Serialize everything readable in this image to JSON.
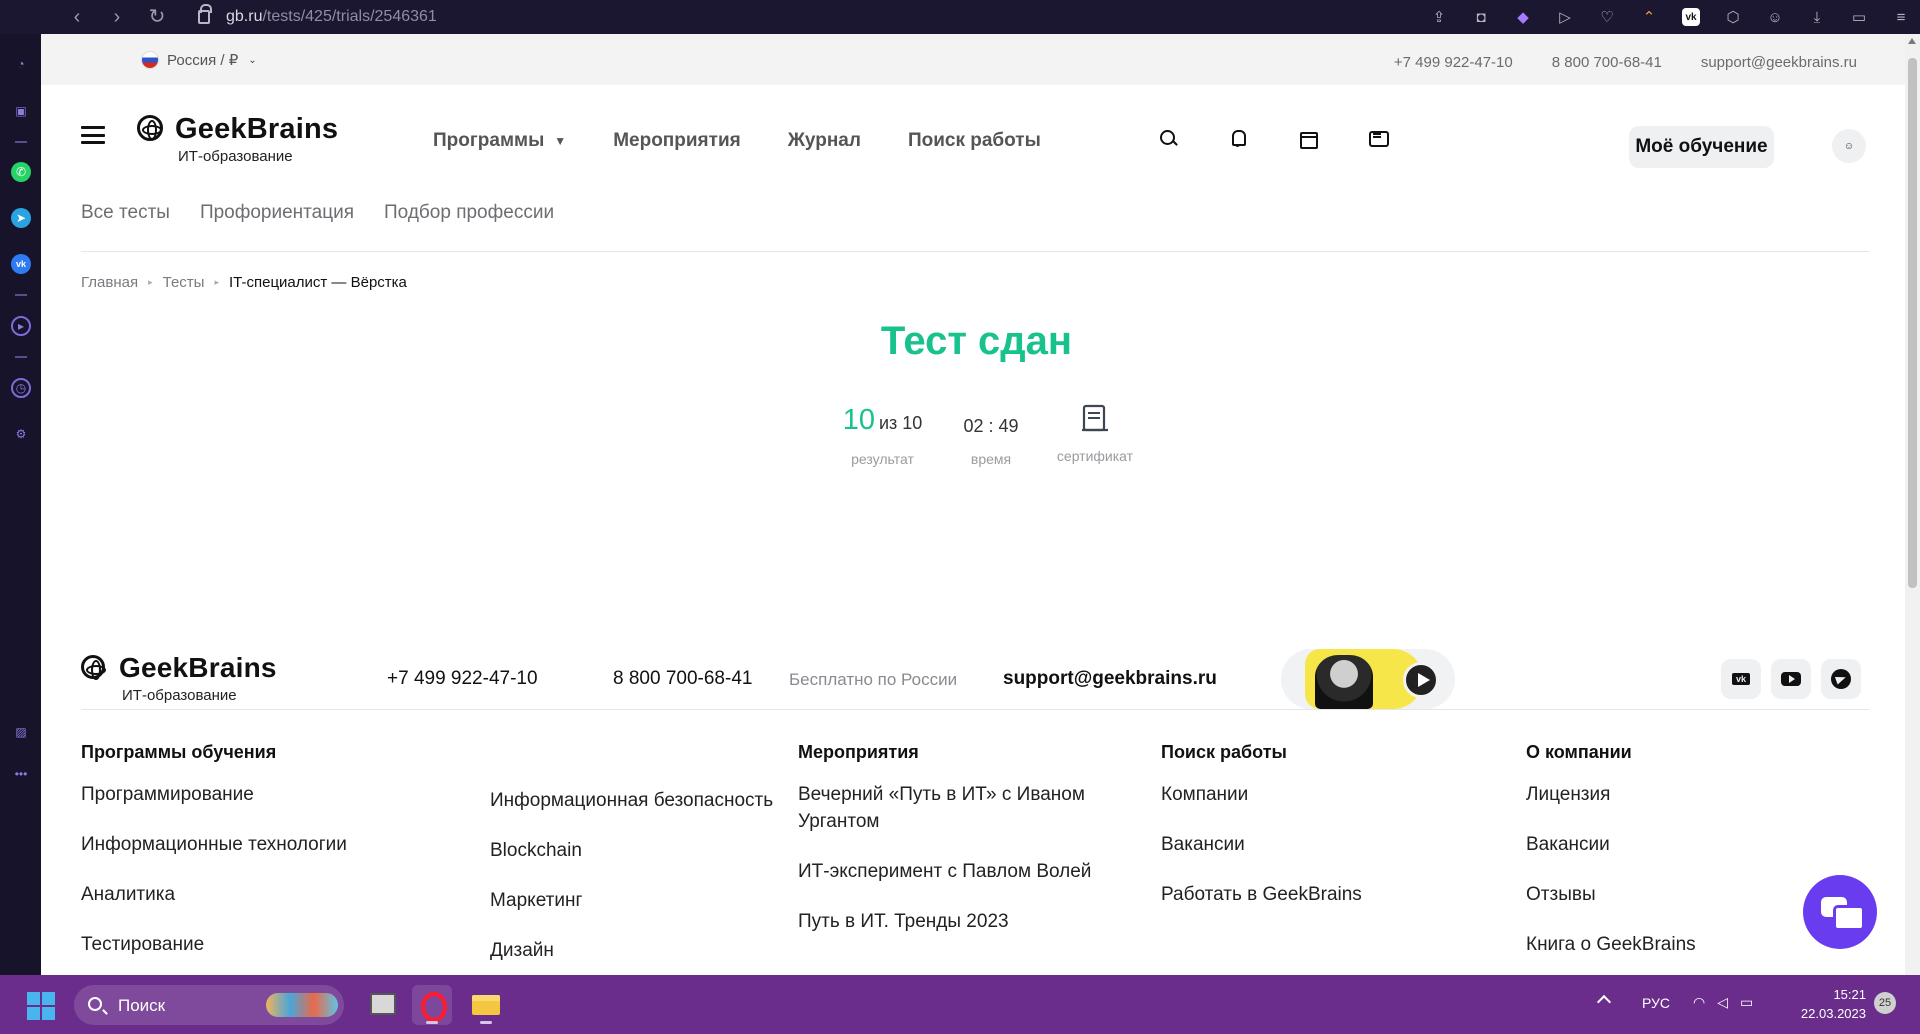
{
  "browser": {
    "url_host": "gb.ru",
    "url_path": "/tests/425/trials/2546361"
  },
  "topline": {
    "region": "Россия / ₽",
    "phone1": "+7 499 922-47-10",
    "phone2": "8 800 700-68-41",
    "email": "support@geekbrains.ru"
  },
  "header": {
    "logo_title": "GeekBrains",
    "logo_sub": "ИТ-образование",
    "nav": [
      "Программы",
      "Мероприятия",
      "Журнал",
      "Поиск работы"
    ],
    "learn_button": "Моё обучение"
  },
  "subnav": [
    "Все тесты",
    "Профориентация",
    "Подбор профессии"
  ],
  "breadcrumb": {
    "home": "Главная",
    "tests": "Тесты",
    "current": "IT-специалист — Вёрстка"
  },
  "result": {
    "title": "Тест сдан",
    "score": "10",
    "score_of": "из 10",
    "score_label": "результат",
    "time": "02 : 49",
    "time_label": "время",
    "cert_label": "сертификат"
  },
  "footer": {
    "logo_title": "GeekBrains",
    "logo_sub": "ИТ-образование",
    "phone1": "+7 499 922-47-10",
    "phone2": "8 800 700-68-41",
    "free_note": "Бесплатно по России",
    "email": "support@geekbrains.ru",
    "columns": {
      "programs": {
        "title": "Программы обучения",
        "left": [
          "Программирование",
          "Информационные технологии",
          "Аналитика",
          "Тестирование"
        ],
        "right": [
          "Информационная безопасность",
          "Blockchain",
          "Маркетинг",
          "Дизайн"
        ]
      },
      "events": {
        "title": "Мероприятия",
        "items": [
          "Вечерний «Путь в ИТ» с Иваном Ургантом",
          "ИТ-эксперимент с Павлом Волей",
          "Путь в ИТ. Тренды 2023"
        ]
      },
      "jobs": {
        "title": "Поиск работы",
        "items": [
          "Компании",
          "Вакансии",
          "Работать в GeekBrains"
        ]
      },
      "company": {
        "title": "О компании",
        "items": [
          "Лицензия",
          "Вакансии",
          "Отзывы",
          "Книга о GeekBrains"
        ]
      }
    }
  },
  "taskbar": {
    "search_placeholder": "Поиск",
    "lang": "РУС",
    "time": "15:21",
    "date": "22.03.2023",
    "badge": "25"
  }
}
